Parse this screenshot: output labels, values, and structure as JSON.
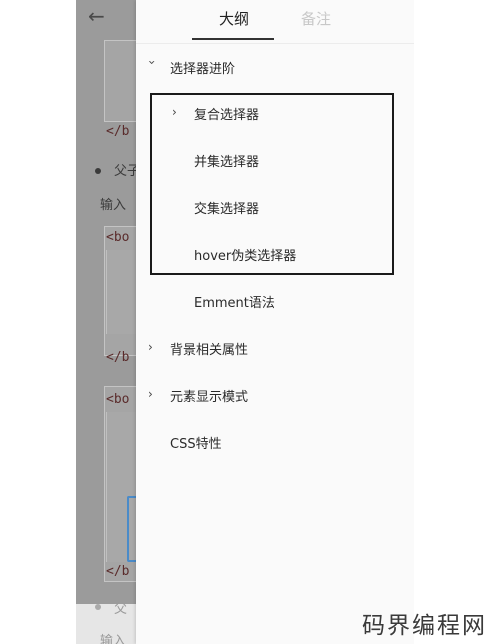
{
  "background_doc": {
    "code_tags": [
      "</b",
      "<bo",
      "</b",
      "<bo",
      "</b"
    ],
    "bullet_text": "父子",
    "input_text": "输入",
    "bottom_bullet_text": "父",
    "bottom_input_text": "输入"
  },
  "outline": {
    "tabs": [
      {
        "label": "大纲",
        "active": true
      },
      {
        "label": "备注",
        "active": false
      }
    ],
    "items": [
      {
        "label": "选择器进阶",
        "level": 1,
        "expanded": true
      },
      {
        "label": "复合选择器",
        "level": 2,
        "expanded": false,
        "has_children": true
      },
      {
        "label": "并集选择器",
        "level": 2
      },
      {
        "label": "交集选择器",
        "level": 2
      },
      {
        "label": "hover伪类选择器",
        "level": 2
      },
      {
        "label": "Emment语法",
        "level": 2
      },
      {
        "label": "背景相关属性",
        "level": 1,
        "expanded": false
      },
      {
        "label": "元素显示模式",
        "level": 1,
        "expanded": false
      },
      {
        "label": "CSS特性",
        "level": 1
      }
    ]
  },
  "watermark": "码界编程网",
  "colors": {
    "drawer_bg": "#fafafa",
    "dim_overlay": "#9b9b9b",
    "highlight_border": "#1a1a1a",
    "active_tab": "#222222",
    "inactive_tab": "#c8c8c8"
  }
}
